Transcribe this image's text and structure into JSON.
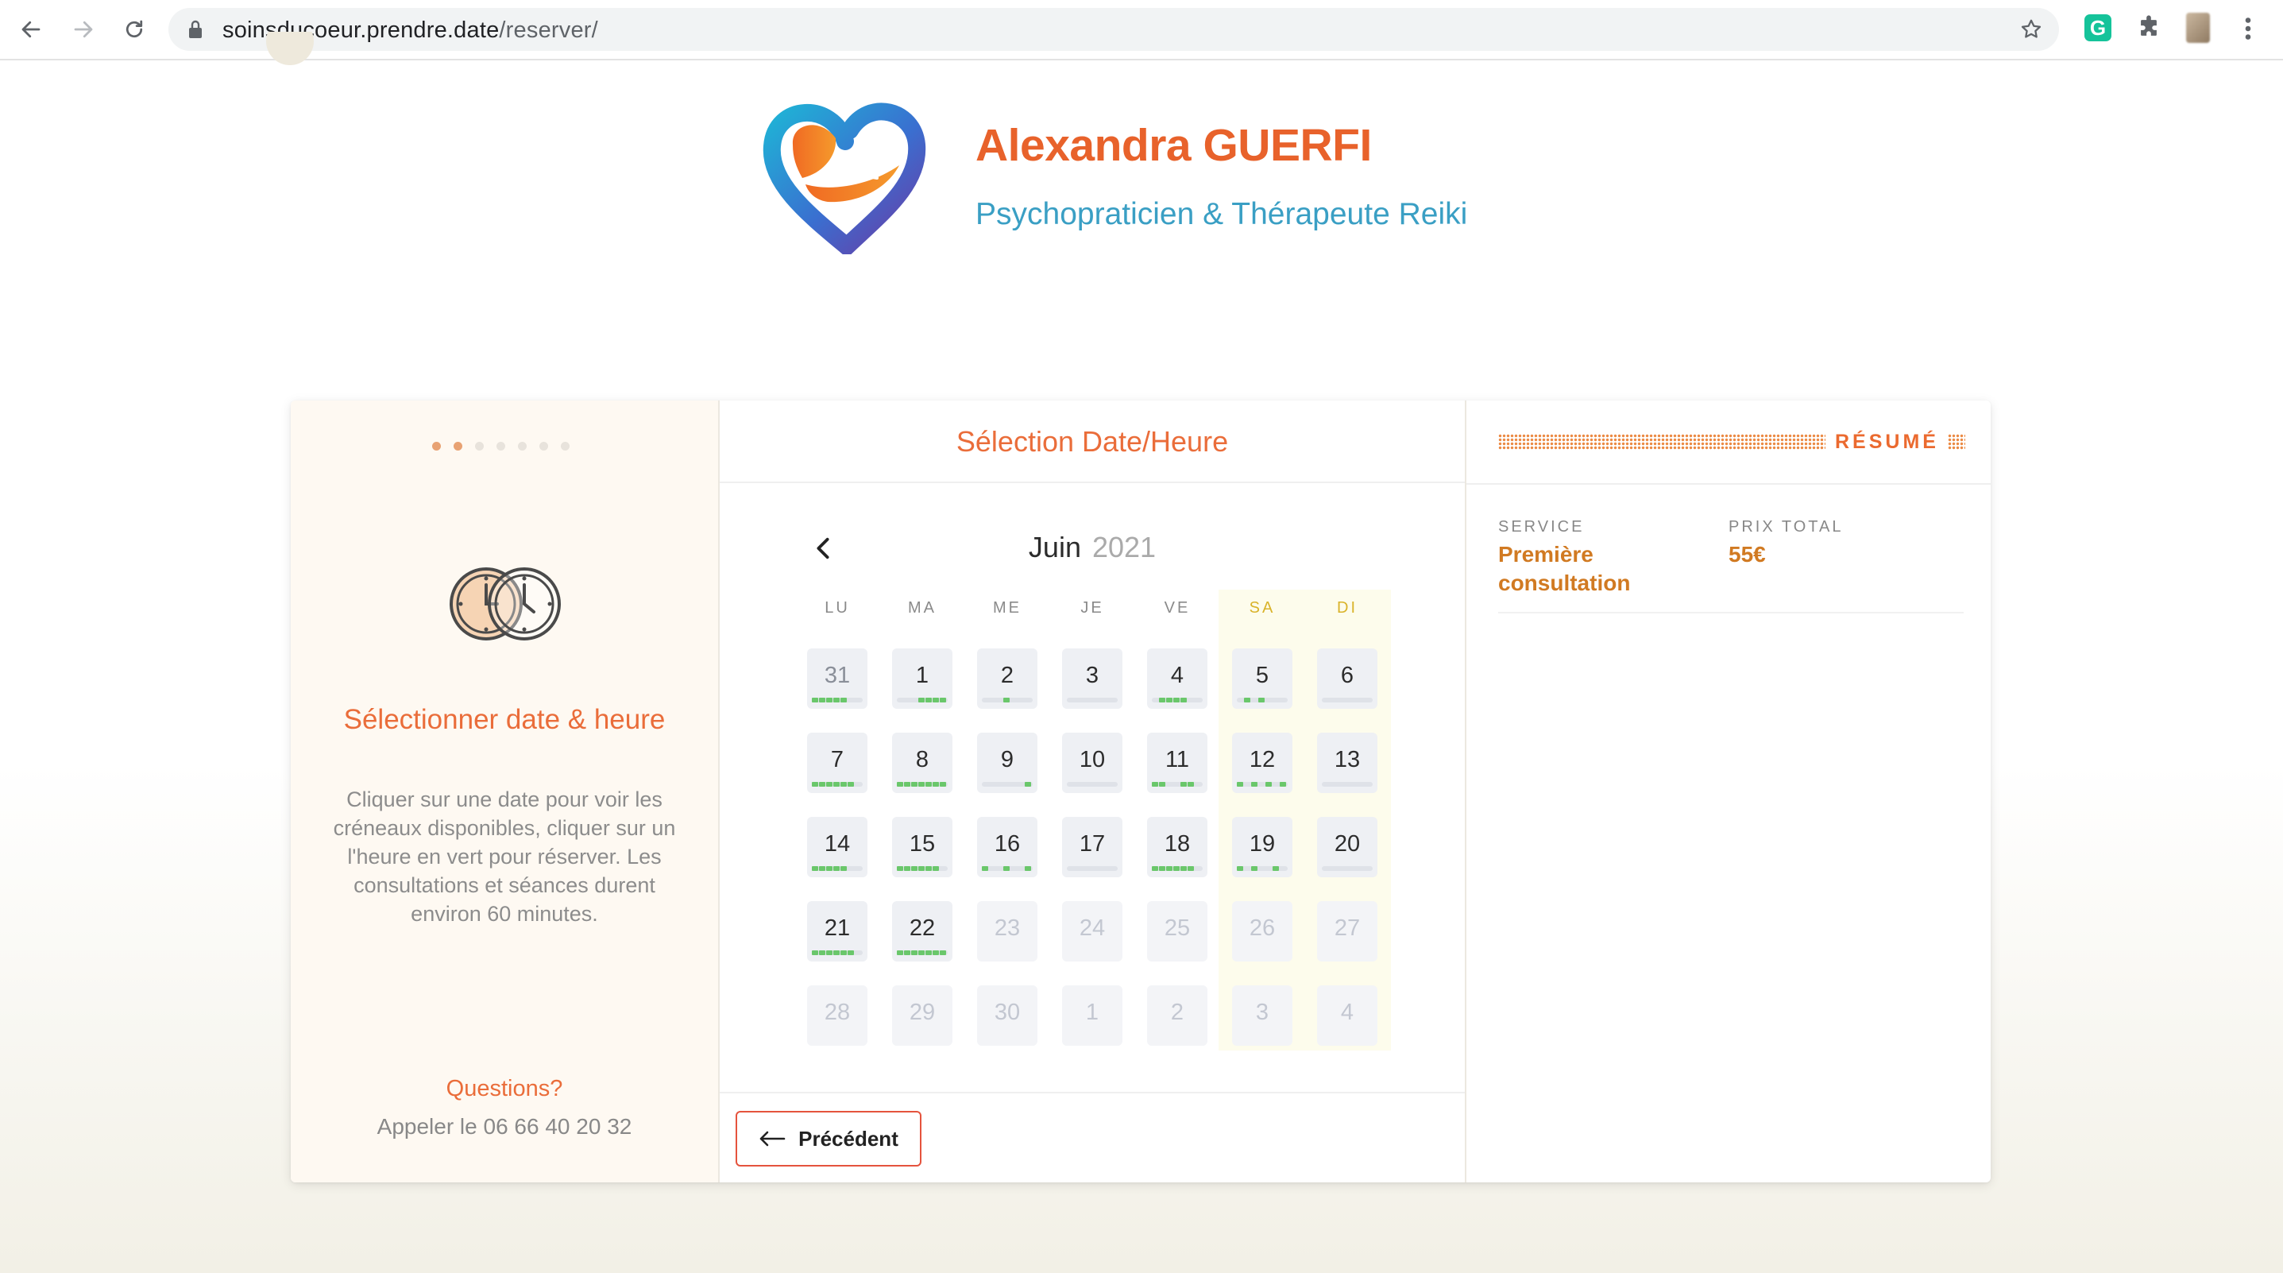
{
  "browser": {
    "url_domain": "soinsducoeur.prendre.date",
    "url_path": "/reserver/",
    "extension_g": "G"
  },
  "brand": {
    "name": "Alexandra GUERFI",
    "subtitle": "Psychopraticien & Thérapeute Reiki"
  },
  "colors": {
    "accent": "#ea6d3a",
    "brand_name": "#e8622b",
    "subtitle": "#3a9fc4",
    "available": "#6ac76b",
    "price": "#d17a22"
  },
  "left": {
    "steps_total": 7,
    "steps_done": 2,
    "icon": "double-clock-icon",
    "title": "Sélectionner date & heure",
    "text": "Cliquer sur une date pour voir les créneaux disponibles, cliquer sur un l'heure en vert pour réserver. Les consultations et séances durent environ 60 minutes.",
    "questions": "Questions?",
    "phone": "Appeler le 06 66 40 20 32"
  },
  "middle": {
    "title": "Sélection Date/Heure",
    "month": "Juin",
    "year": "2021",
    "weekdays": [
      "LU",
      "MA",
      "ME",
      "JE",
      "VE",
      "SA",
      "DI"
    ],
    "days": [
      {
        "n": "31",
        "state": "muted",
        "slots": [
          0,
          1,
          2,
          3,
          4
        ]
      },
      {
        "n": "1",
        "state": "active",
        "slots": [
          3,
          4,
          5,
          6
        ]
      },
      {
        "n": "2",
        "state": "active",
        "slots": [
          3
        ]
      },
      {
        "n": "3",
        "state": "active",
        "slots": []
      },
      {
        "n": "4",
        "state": "active",
        "slots": [
          1,
          2,
          3,
          4
        ]
      },
      {
        "n": "5",
        "state": "active",
        "slots": [
          1,
          3
        ]
      },
      {
        "n": "6",
        "state": "active",
        "slots": []
      },
      {
        "n": "7",
        "state": "active",
        "slots": [
          0,
          1,
          2,
          3,
          4,
          5
        ]
      },
      {
        "n": "8",
        "state": "active",
        "slots": [
          0,
          1,
          2,
          3,
          4,
          5,
          6
        ]
      },
      {
        "n": "9",
        "state": "active",
        "slots": [
          6
        ]
      },
      {
        "n": "10",
        "state": "active",
        "slots": []
      },
      {
        "n": "11",
        "state": "active",
        "slots": [
          0,
          1,
          4,
          5
        ]
      },
      {
        "n": "12",
        "state": "active",
        "slots": [
          0,
          2,
          4,
          6
        ]
      },
      {
        "n": "13",
        "state": "active",
        "slots": []
      },
      {
        "n": "14",
        "state": "active",
        "slots": [
          0,
          1,
          2,
          3,
          4
        ]
      },
      {
        "n": "15",
        "state": "active",
        "slots": [
          0,
          1,
          2,
          3,
          4,
          5
        ]
      },
      {
        "n": "16",
        "state": "active",
        "slots": [
          0,
          3,
          6
        ]
      },
      {
        "n": "17",
        "state": "active",
        "slots": []
      },
      {
        "n": "18",
        "state": "active",
        "slots": [
          0,
          1,
          2,
          3,
          4,
          5
        ]
      },
      {
        "n": "19",
        "state": "active",
        "slots": [
          0,
          2,
          5
        ]
      },
      {
        "n": "20",
        "state": "active",
        "slots": []
      },
      {
        "n": "21",
        "state": "active",
        "slots": [
          0,
          1,
          2,
          3,
          4,
          5
        ]
      },
      {
        "n": "22",
        "state": "active",
        "slots": [
          0,
          1,
          2,
          3,
          4,
          5,
          6
        ]
      },
      {
        "n": "23",
        "state": "disabled",
        "slots": []
      },
      {
        "n": "24",
        "state": "disabled",
        "slots": []
      },
      {
        "n": "25",
        "state": "disabled",
        "slots": []
      },
      {
        "n": "26",
        "state": "disabled",
        "slots": []
      },
      {
        "n": "27",
        "state": "disabled",
        "slots": []
      },
      {
        "n": "28",
        "state": "disabled",
        "slots": []
      },
      {
        "n": "29",
        "state": "disabled",
        "slots": []
      },
      {
        "n": "30",
        "state": "disabled",
        "slots": []
      },
      {
        "n": "1",
        "state": "disabled",
        "slots": []
      },
      {
        "n": "2",
        "state": "disabled",
        "slots": []
      },
      {
        "n": "3",
        "state": "disabled",
        "slots": []
      },
      {
        "n": "4",
        "state": "disabled",
        "slots": []
      }
    ],
    "prev_button": "Précédent"
  },
  "right": {
    "title": "RÉSUMÉ",
    "service_label": "SERVICE",
    "service_value": "Première consultation",
    "price_label": "PRIX TOTAL",
    "price_value": "55€"
  }
}
